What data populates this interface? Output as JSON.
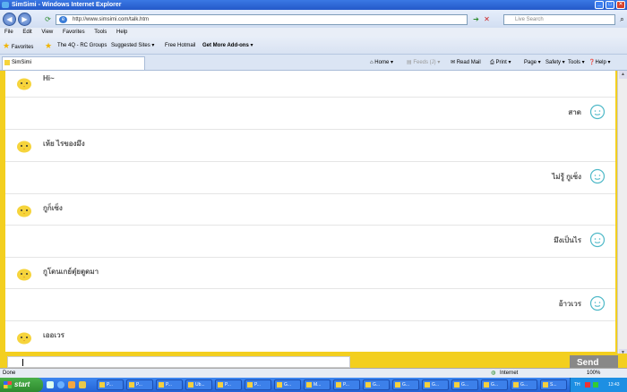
{
  "window": {
    "title": "SimSimi - Windows Internet Explorer"
  },
  "address": {
    "url": "http://www.simsimi.com/talk.htm",
    "search_placeholder": "Live Search"
  },
  "menu": [
    "File",
    "Edit",
    "View",
    "Favorites",
    "Tools",
    "Help"
  ],
  "favorites": {
    "label": "Favorites",
    "items": [
      "The 4Q - RC Groups",
      "Suggested Sites ▾",
      "Free Hotmail",
      "Get More Add-ons ▾"
    ]
  },
  "tab": {
    "title": "SimSimi"
  },
  "commands": [
    "Home ▾",
    "Feeds (J) ▾",
    "Read Mail",
    "Print ▾",
    "Page ▾",
    "Safety ▾",
    "Tools ▾",
    "Help ▾"
  ],
  "chat": [
    {
      "from": "bot",
      "text": "Hi~"
    },
    {
      "from": "user",
      "text": "สาด"
    },
    {
      "from": "bot",
      "text": "เห้ย ไรของมึง"
    },
    {
      "from": "user",
      "text": "ไม่รู้ กูเซ็ง"
    },
    {
      "from": "bot",
      "text": "กูก็เซ็ง"
    },
    {
      "from": "user",
      "text": "มึงเป็นไร"
    },
    {
      "from": "bot",
      "text": "กูโดนเกย์ตุ๋ยตูดมา"
    },
    {
      "from": "user",
      "text": "อ้าวเวร"
    },
    {
      "from": "bot",
      "text": "เออเวร"
    }
  ],
  "input": {
    "send_label": "Send"
  },
  "status": {
    "left": "Done",
    "zone": "Internet",
    "zoom": "100%"
  },
  "taskbar": {
    "start": "start",
    "tasks": [
      "P...",
      "P...",
      "P...",
      "Ub...",
      "P...",
      "P...",
      "G...",
      "M...",
      "P...",
      "G...",
      "G...",
      "G...",
      "G...",
      "G...",
      "G...",
      "S...",
      "Cl...",
      "G...",
      "G...",
      "G..."
    ],
    "tray_lang": "TH",
    "clock": "13:43"
  },
  "colors": {
    "accent": "#f3cf1f",
    "taskbar": "#2463d6",
    "send": "#888888"
  }
}
